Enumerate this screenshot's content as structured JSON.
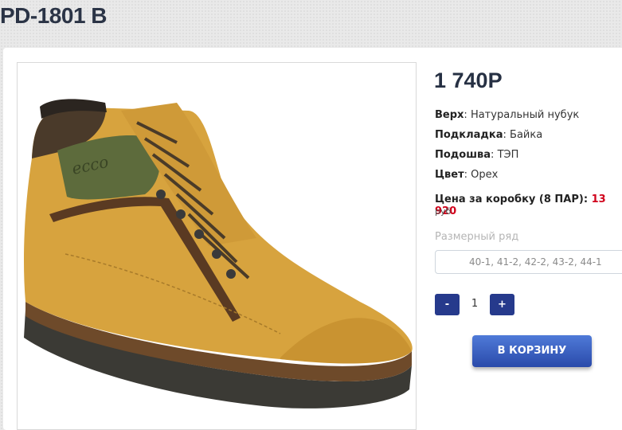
{
  "product": {
    "title": "PD-1801 B",
    "price": "1 740Р",
    "specs": [
      {
        "label": "Верх",
        "value": "Натуральный нубук"
      },
      {
        "label": "Подкладка",
        "value": "Байка"
      },
      {
        "label": "Подошва",
        "value": "ТЭП"
      },
      {
        "label": "Цвет",
        "value": "Орех"
      }
    ],
    "box_price_label": "Цена за коробку (8 ПАР):",
    "box_price_value": "13 920",
    "currency": "руб",
    "size_label": "Размерный ряд",
    "size_value": "40-1, 41-2, 42-2, 43-2, 44-1",
    "brand_mark": "ecco"
  },
  "cart": {
    "minus_label": "-",
    "quantity": "1",
    "plus_label": "+",
    "add_label": "В КОРЗИНУ"
  }
}
